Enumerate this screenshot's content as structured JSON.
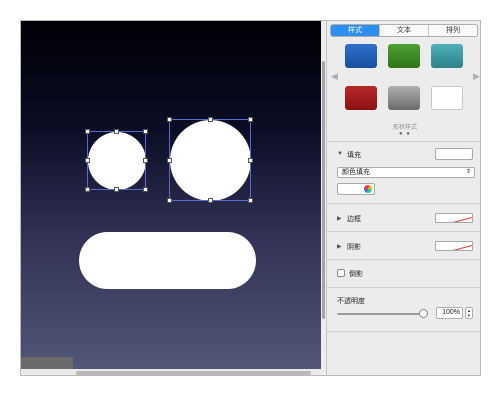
{
  "panel": {
    "tabs": [
      {
        "label": "样式",
        "active": true
      },
      {
        "label": "文本",
        "active": false
      },
      {
        "label": "排列",
        "active": false
      }
    ],
    "shape_styles": {
      "label": "形状样式",
      "swatches": [
        {
          "name": "blue",
          "color": "#1f5fb8"
        },
        {
          "name": "green",
          "color": "#3d8a24"
        },
        {
          "name": "teal",
          "color": "#3a9aa3"
        },
        {
          "name": "red",
          "color": "#a31c1c"
        },
        {
          "name": "gray",
          "color": "#8d8d8d"
        },
        {
          "name": "white",
          "color": "#ffffff"
        }
      ],
      "page_dots": "● ●"
    },
    "fill": {
      "label": "填充",
      "type_value": "颜色填充"
    },
    "border": {
      "label": "边框"
    },
    "shadow": {
      "label": "阴影"
    },
    "reflection": {
      "label": "倒影",
      "checked": false
    },
    "opacity": {
      "label": "不透明度",
      "value": 1.0,
      "value_text": "100%"
    }
  },
  "colors": {
    "accent": "#2d8ff4",
    "selection": "#5a6bd0"
  }
}
